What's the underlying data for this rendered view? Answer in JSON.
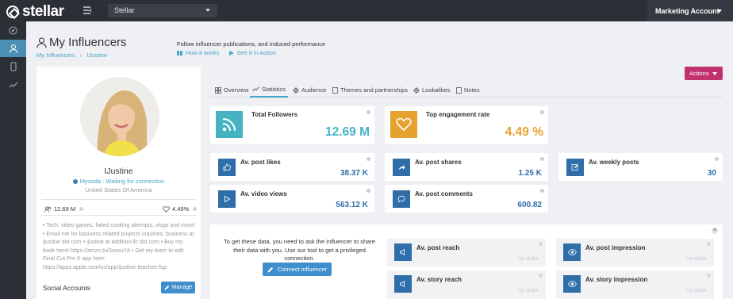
{
  "app": {
    "name": "stellar"
  },
  "topbar": {
    "workspace": "Stellar",
    "account": "Marketing Account"
  },
  "header": {
    "title": "My Influencers",
    "breadcrumb": [
      "My Influencers",
      "IJustine"
    ],
    "description": "Follow influencer publications, and induced performance",
    "links": [
      "How it works",
      "See it in Action"
    ],
    "actions_label": "Actions"
  },
  "profile": {
    "name": "IJustine",
    "status": "Mysoda : Waiting for connection",
    "country": "United States Of America",
    "followers": "12.69 M",
    "engagement": "4.49%",
    "bio": "• Tech, video games, failed cooking attempts, vlogs and more! • Email me for business related projects inquiries: business at ijustine dot com • ijustine at addition-llc dot com • Buy my book here! https://amzn.to/3vsouYA • Get my learn to edit Final Cut Pro X app here: https://apps.apple.com/us/app/ijustine-teaches-fcp-",
    "social_label": "Social Accounts",
    "manage_label": "Manage"
  },
  "tabs": [
    {
      "label": "Overview",
      "icon": "grid-icon"
    },
    {
      "label": "Statistics",
      "icon": "chart-line-icon",
      "active": true
    },
    {
      "label": "Audience",
      "icon": "crosshair-icon"
    },
    {
      "label": "Themes and partnerships",
      "icon": "document-icon"
    },
    {
      "label": "Lookalikes",
      "icon": "crosshair-icon"
    },
    {
      "label": "Notes",
      "icon": "document-icon"
    }
  ],
  "stats": {
    "total_followers": {
      "label": "Total Followers",
      "value": "12.69 M",
      "color": "#45b3c4"
    },
    "engagement_rate": {
      "label": "Top engagement rate",
      "value": "4.49 %",
      "color": "#e6a22f"
    },
    "post_likes": {
      "label": "Av. post likes",
      "value": "38.37 K"
    },
    "post_shares": {
      "label": "Av. post shares",
      "value": "1.25 K"
    },
    "weekly_posts": {
      "label": "Av. weekly posts",
      "value": "30"
    },
    "video_views": {
      "label": "Av. video views",
      "value": "563.12 K"
    },
    "post_comments": {
      "label": "Av. post comments",
      "value": "600.82"
    }
  },
  "privileged": {
    "text": "To get these data, you need to ask the influencer to share their data with you. Use our tool to get a privileged connection.",
    "connect_label": "Connect influencer",
    "cards": [
      {
        "label": "Av. post reach",
        "value": "no data",
        "icon": "speaker-icon"
      },
      {
        "label": "Av. post impression",
        "value": "no data",
        "icon": "eye-icon"
      },
      {
        "label": "Av. story reach",
        "value": "no data",
        "icon": "speaker-icon"
      },
      {
        "label": "Av. story impression",
        "value": "no data",
        "icon": "eye-icon"
      }
    ]
  }
}
